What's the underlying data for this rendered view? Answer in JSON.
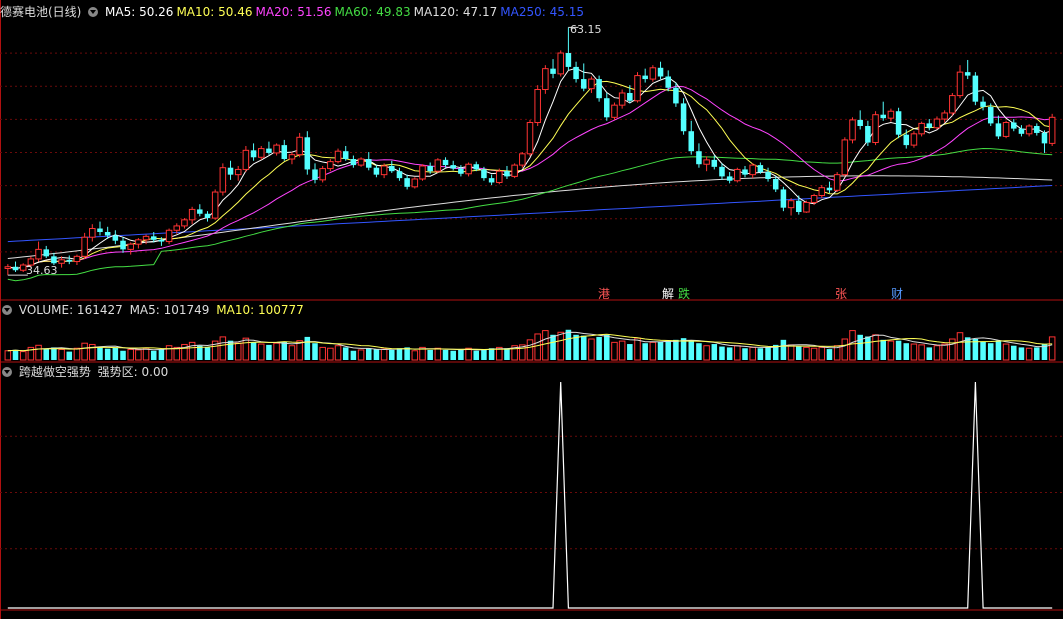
{
  "header": {
    "stock_name": "德赛电池(日线)",
    "ma": [
      {
        "label": "MA5: 50.26",
        "color": "#ffffff"
      },
      {
        "label": "MA10: 50.46",
        "color": "#ffff55"
      },
      {
        "label": "MA20: 51.56",
        "color": "#ff44ff"
      },
      {
        "label": "MA60: 49.83",
        "color": "#44dd44"
      },
      {
        "label": "MA120: 47.17",
        "color": "#dddddd"
      },
      {
        "label": "MA250: 45.15",
        "color": "#3355ff"
      }
    ]
  },
  "volume_header": {
    "label": "VOLUME: 161427",
    "ma5": "MA5: 101749",
    "ma10": "MA10: 100777"
  },
  "indicator_header": {
    "name": "跨越做空强势",
    "value": "强势区: 0.00"
  },
  "events": [
    {
      "text": "港",
      "color": "#ff5555"
    },
    {
      "text": "解",
      "color": "#ffffff"
    },
    {
      "text": "跌",
      "color": "#44dd44"
    },
    {
      "text": "张",
      "color": "#ff5555"
    },
    {
      "text": "财",
      "color": "#5599ff"
    }
  ],
  "chart_data": [
    {
      "type": "candlestick",
      "title": "德赛电池(日线)",
      "high_label": "63.15",
      "low_label": "34.63",
      "ohlc": [
        [
          35.4,
          35.9,
          34.63,
          35.6
        ],
        [
          35.6,
          36.2,
          35.0,
          35.2
        ],
        [
          35.2,
          36.0,
          35.0,
          35.8
        ],
        [
          35.8,
          36.8,
          35.5,
          36.5
        ],
        [
          36.5,
          38.5,
          36.2,
          37.6
        ],
        [
          37.6,
          38.0,
          36.6,
          36.8
        ],
        [
          36.8,
          37.2,
          35.8,
          36.0
        ],
        [
          36.0,
          36.8,
          35.5,
          36.4
        ],
        [
          36.4,
          36.9,
          35.9,
          36.2
        ],
        [
          36.2,
          37.0,
          35.8,
          36.8
        ],
        [
          36.8,
          39.5,
          36.5,
          39.0
        ],
        [
          39.0,
          40.5,
          38.5,
          40.0
        ],
        [
          40.0,
          40.8,
          39.2,
          39.6
        ],
        [
          39.6,
          40.2,
          38.8,
          39.2
        ],
        [
          39.2,
          39.8,
          38.2,
          38.6
        ],
        [
          38.6,
          39.0,
          37.2,
          37.6
        ],
        [
          37.6,
          38.4,
          37.0,
          38.2
        ],
        [
          38.2,
          38.9,
          37.7,
          38.7
        ],
        [
          38.7,
          39.3,
          38.2,
          39.1
        ],
        [
          39.1,
          39.6,
          38.4,
          38.7
        ],
        [
          38.7,
          39.0,
          38.0,
          38.5
        ],
        [
          38.5,
          40.0,
          38.2,
          39.8
        ],
        [
          39.8,
          40.6,
          39.4,
          40.3
        ],
        [
          40.3,
          41.2,
          40.0,
          41.0
        ],
        [
          41.0,
          42.5,
          40.5,
          42.2
        ],
        [
          42.2,
          42.8,
          41.4,
          41.7
        ],
        [
          41.7,
          42.0,
          40.8,
          41.2
        ],
        [
          41.2,
          44.5,
          41.0,
          44.2
        ],
        [
          44.2,
          47.5,
          43.8,
          47.0
        ],
        [
          47.0,
          47.8,
          45.6,
          46.2
        ],
        [
          46.2,
          47.2,
          45.5,
          46.8
        ],
        [
          46.8,
          49.5,
          46.5,
          49.0
        ],
        [
          49.0,
          49.8,
          47.8,
          48.2
        ],
        [
          48.2,
          49.5,
          47.9,
          49.2
        ],
        [
          49.2,
          50.0,
          48.5,
          48.7
        ],
        [
          48.7,
          49.8,
          48.4,
          49.6
        ],
        [
          49.6,
          50.2,
          47.8,
          48.0
        ],
        [
          48.0,
          48.8,
          47.4,
          48.5
        ],
        [
          48.5,
          51.0,
          48.2,
          50.5
        ],
        [
          50.5,
          51.2,
          46.2,
          46.8
        ],
        [
          46.8,
          47.5,
          45.2,
          45.6
        ],
        [
          45.6,
          47.2,
          45.3,
          46.9
        ],
        [
          46.9,
          48.0,
          46.6,
          47.7
        ],
        [
          47.7,
          49.2,
          47.5,
          48.9
        ],
        [
          48.9,
          49.5,
          47.8,
          48.0
        ],
        [
          48.0,
          48.4,
          47.0,
          47.3
        ],
        [
          47.3,
          48.2,
          47.1,
          48.0
        ],
        [
          48.0,
          48.8,
          46.7,
          47.0
        ],
        [
          47.0,
          47.3,
          45.9,
          46.2
        ],
        [
          46.2,
          47.5,
          45.8,
          47.2
        ],
        [
          47.2,
          47.8,
          46.4,
          46.6
        ],
        [
          46.6,
          47.0,
          45.5,
          45.8
        ],
        [
          45.8,
          46.2,
          44.5,
          44.8
        ],
        [
          44.8,
          45.9,
          44.6,
          45.7
        ],
        [
          45.7,
          47.4,
          45.5,
          47.2
        ],
        [
          47.2,
          47.6,
          46.3,
          46.6
        ],
        [
          46.6,
          48.1,
          46.4,
          47.9
        ],
        [
          47.9,
          48.2,
          47.0,
          47.3
        ],
        [
          47.3,
          47.8,
          46.7,
          46.9
        ],
        [
          46.9,
          47.3,
          46.0,
          46.3
        ],
        [
          46.3,
          47.6,
          46.0,
          47.4
        ],
        [
          47.4,
          47.7,
          46.6,
          46.8
        ],
        [
          46.8,
          47.1,
          45.5,
          45.8
        ],
        [
          45.8,
          46.2,
          45.0,
          45.3
        ],
        [
          45.3,
          46.9,
          45.1,
          46.6
        ],
        [
          46.6,
          47.2,
          45.7,
          46.0
        ],
        [
          46.0,
          47.5,
          45.8,
          47.3
        ],
        [
          47.3,
          48.8,
          47.0,
          48.6
        ],
        [
          48.6,
          52.5,
          48.3,
          52.2
        ],
        [
          52.2,
          56.5,
          51.8,
          56.0
        ],
        [
          56.0,
          58.8,
          55.5,
          58.4
        ],
        [
          58.4,
          59.5,
          57.3,
          57.8
        ],
        [
          57.8,
          60.5,
          57.5,
          60.2
        ],
        [
          60.2,
          63.15,
          58.2,
          58.6
        ],
        [
          58.6,
          59.2,
          56.8,
          57.2
        ],
        [
          57.2,
          59.0,
          55.8,
          56.1
        ],
        [
          56.1,
          57.5,
          55.6,
          57.2
        ],
        [
          57.2,
          57.6,
          54.6,
          55.0
        ],
        [
          55.0,
          55.6,
          52.4,
          52.8
        ],
        [
          52.8,
          54.5,
          52.5,
          54.2
        ],
        [
          54.2,
          56.0,
          53.8,
          55.6
        ],
        [
          55.6,
          56.5,
          54.4,
          54.7
        ],
        [
          54.7,
          58.0,
          54.5,
          57.6
        ],
        [
          57.6,
          58.4,
          56.8,
          57.2
        ],
        [
          57.2,
          58.8,
          56.9,
          58.5
        ],
        [
          58.5,
          59.2,
          57.2,
          57.5
        ],
        [
          57.5,
          58.2,
          55.8,
          56.2
        ],
        [
          56.2,
          56.8,
          54.0,
          54.4
        ],
        [
          54.4,
          55.0,
          50.8,
          51.2
        ],
        [
          51.2,
          52.4,
          48.5,
          48.9
        ],
        [
          48.9,
          49.8,
          47.0,
          47.4
        ],
        [
          47.4,
          48.3,
          46.6,
          47.9
        ],
        [
          47.9,
          48.4,
          46.8,
          47.1
        ],
        [
          47.1,
          47.5,
          45.6,
          46.0
        ],
        [
          46.0,
          46.5,
          45.2,
          45.5
        ],
        [
          45.5,
          47.0,
          45.3,
          46.8
        ],
        [
          46.8,
          47.2,
          45.9,
          46.2
        ],
        [
          46.2,
          47.5,
          45.8,
          47.3
        ],
        [
          47.3,
          47.6,
          46.3,
          46.5
        ],
        [
          46.5,
          47.0,
          45.4,
          45.7
        ],
        [
          45.7,
          46.0,
          44.2,
          44.5
        ],
        [
          44.5,
          44.8,
          42.0,
          42.4
        ],
        [
          42.4,
          43.5,
          41.5,
          43.2
        ],
        [
          43.2,
          43.8,
          41.6,
          41.9
        ],
        [
          41.9,
          43.2,
          41.8,
          43.0
        ],
        [
          43.0,
          44.0,
          42.7,
          43.8
        ],
        [
          43.8,
          45.0,
          43.5,
          44.7
        ],
        [
          44.7,
          45.4,
          44.1,
          44.4
        ],
        [
          44.4,
          46.5,
          44.2,
          46.2
        ],
        [
          46.2,
          50.5,
          46.0,
          50.2
        ],
        [
          50.2,
          52.8,
          49.8,
          52.5
        ],
        [
          52.5,
          53.6,
          51.4,
          51.8
        ],
        [
          51.8,
          52.4,
          49.5,
          49.9
        ],
        [
          49.9,
          53.5,
          49.6,
          53.1
        ],
        [
          53.1,
          54.6,
          52.4,
          52.7
        ],
        [
          52.7,
          53.8,
          52.3,
          53.5
        ],
        [
          53.5,
          53.9,
          50.4,
          50.8
        ],
        [
          50.8,
          51.4,
          49.2,
          49.6
        ],
        [
          49.6,
          51.2,
          49.3,
          50.9
        ],
        [
          50.9,
          52.3,
          50.6,
          52.1
        ],
        [
          52.1,
          52.6,
          51.3,
          51.6
        ],
        [
          51.6,
          52.9,
          51.4,
          52.6
        ],
        [
          52.6,
          53.6,
          52.2,
          53.3
        ],
        [
          53.3,
          55.6,
          53.0,
          55.3
        ],
        [
          55.3,
          58.8,
          55.0,
          58.0
        ],
        [
          58.0,
          59.4,
          57.2,
          57.6
        ],
        [
          57.6,
          58.0,
          54.2,
          54.6
        ],
        [
          54.6,
          55.2,
          53.6,
          54.0
        ],
        [
          54.0,
          54.4,
          51.8,
          52.1
        ],
        [
          52.1,
          53.0,
          50.3,
          50.6
        ],
        [
          50.6,
          52.4,
          50.4,
          52.2
        ],
        [
          52.2,
          52.6,
          51.2,
          51.5
        ],
        [
          51.5,
          51.9,
          50.6,
          50.9
        ],
        [
          50.9,
          52.0,
          50.6,
          51.8
        ],
        [
          51.8,
          52.1,
          50.7,
          51.0
        ],
        [
          51.0,
          51.3,
          48.7,
          49.8
        ],
        [
          49.8,
          53.2,
          49.5,
          52.8
        ]
      ],
      "ma_series_names": [
        "MA5",
        "MA10",
        "MA20",
        "MA60",
        "MA120",
        "MA250"
      ]
    },
    {
      "type": "bar",
      "title": "VOLUME",
      "volume_relative": [
        0.22,
        0.24,
        0.2,
        0.3,
        0.35,
        0.27,
        0.3,
        0.25,
        0.2,
        0.28,
        0.4,
        0.37,
        0.32,
        0.27,
        0.3,
        0.22,
        0.25,
        0.24,
        0.28,
        0.22,
        0.26,
        0.34,
        0.3,
        0.37,
        0.42,
        0.34,
        0.3,
        0.45,
        0.55,
        0.46,
        0.4,
        0.52,
        0.42,
        0.38,
        0.36,
        0.4,
        0.44,
        0.34,
        0.46,
        0.55,
        0.4,
        0.3,
        0.28,
        0.34,
        0.3,
        0.22,
        0.24,
        0.28,
        0.25,
        0.26,
        0.24,
        0.28,
        0.3,
        0.22,
        0.3,
        0.24,
        0.28,
        0.24,
        0.22,
        0.24,
        0.28,
        0.22,
        0.26,
        0.28,
        0.3,
        0.28,
        0.34,
        0.36,
        0.48,
        0.62,
        0.7,
        0.6,
        0.66,
        0.72,
        0.6,
        0.58,
        0.5,
        0.55,
        0.6,
        0.42,
        0.45,
        0.38,
        0.52,
        0.4,
        0.42,
        0.44,
        0.46,
        0.48,
        0.52,
        0.45,
        0.4,
        0.34,
        0.38,
        0.32,
        0.3,
        0.34,
        0.28,
        0.3,
        0.28,
        0.3,
        0.36,
        0.48,
        0.36,
        0.32,
        0.3,
        0.28,
        0.3,
        0.26,
        0.34,
        0.5,
        0.7,
        0.6,
        0.56,
        0.6,
        0.48,
        0.45,
        0.46,
        0.4,
        0.38,
        0.36,
        0.3,
        0.34,
        0.38,
        0.5,
        0.65,
        0.54,
        0.5,
        0.44,
        0.4,
        0.46,
        0.38,
        0.34,
        0.3,
        0.28,
        0.3,
        0.38,
        0.55
      ]
    },
    {
      "type": "line",
      "title": "跨越做空强势",
      "spikes_at_index": [
        72,
        126
      ],
      "ylim": [
        0,
        1
      ]
    }
  ]
}
